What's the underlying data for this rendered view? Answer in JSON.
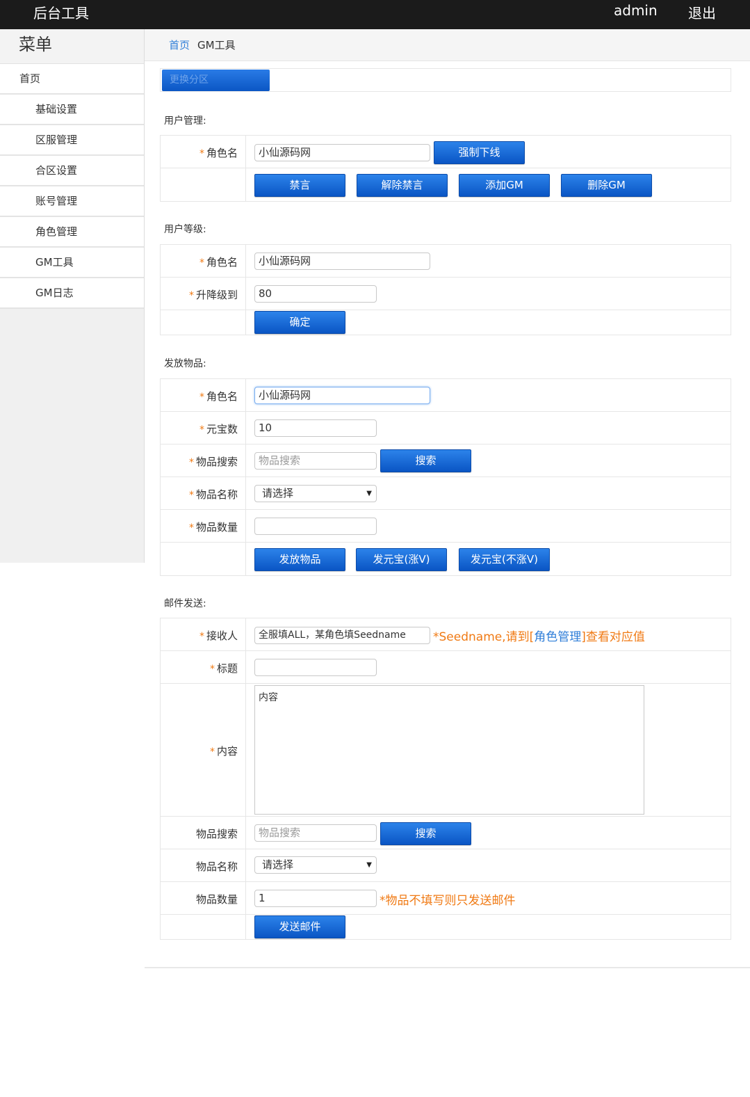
{
  "topbar": {
    "brand": "后台工具",
    "user": "admin",
    "logout": "退出"
  },
  "sidebar": {
    "title": "菜单",
    "items": [
      {
        "label": "首页",
        "level": 1
      },
      {
        "label": "基础设置",
        "level": 2
      },
      {
        "label": "区服管理",
        "level": 2
      },
      {
        "label": "合区设置",
        "level": 2
      },
      {
        "label": "账号管理",
        "level": 2
      },
      {
        "label": "角色管理",
        "level": 2
      },
      {
        "label": "GM工具",
        "level": 2
      },
      {
        "label": "GM日志",
        "level": 2
      }
    ]
  },
  "breadcrumb": {
    "home": "首页",
    "current": "GM工具"
  },
  "zone": {
    "button": "更换分区"
  },
  "user_mgmt": {
    "title": "用户管理:",
    "role_label": "角色名",
    "role_value": "小仙源码网",
    "kick_button": "强制下线",
    "mute_button": "禁言",
    "unmute_button": "解除禁言",
    "add_gm_button": "添加GM",
    "del_gm_button": "删除GM"
  },
  "user_level": {
    "title": "用户等级:",
    "role_label": "角色名",
    "role_value": "小仙源码网",
    "level_label": "升降级到",
    "level_value": "80",
    "confirm_button": "确定"
  },
  "give_items": {
    "title": "发放物品:",
    "role_label": "角色名",
    "role_value": "小仙源码网",
    "yuanbao_label": "元宝数",
    "yuanbao_value": "10",
    "search_label": "物品搜索",
    "search_placeholder": "物品搜索",
    "search_button": "搜索",
    "name_label": "物品名称",
    "name_selected": "请选择",
    "qty_label": "物品数量",
    "qty_value": "",
    "give_button": "发放物品",
    "yuanbao_button": "发元宝(涨V)",
    "yuanbao_novip_button": "发元宝(不涨V)"
  },
  "mail": {
    "title": "邮件发送:",
    "recipient_label": "接收人",
    "recipient_value": "全服填ALL，某角色填Seedname",
    "recipient_note_prefix": "*Seedname,请到[",
    "recipient_note_link": "角色管理",
    "recipient_note_suffix": "]查看对应值",
    "subject_label": "标题",
    "subject_value": "",
    "content_label": "内容",
    "content_value": "内容",
    "search_label": "物品搜索",
    "search_placeholder": "物品搜索",
    "search_button": "搜索",
    "name_label": "物品名称",
    "name_selected": "请选择",
    "qty_label": "物品数量",
    "qty_value": "1",
    "qty_note": "*物品不填写则只发送邮件",
    "send_button": "发送邮件"
  },
  "colors": {
    "accent": "#0b5fd0",
    "warning": "#f07a14",
    "link": "#2f7ed8",
    "topbar": "#1b1b1b"
  }
}
